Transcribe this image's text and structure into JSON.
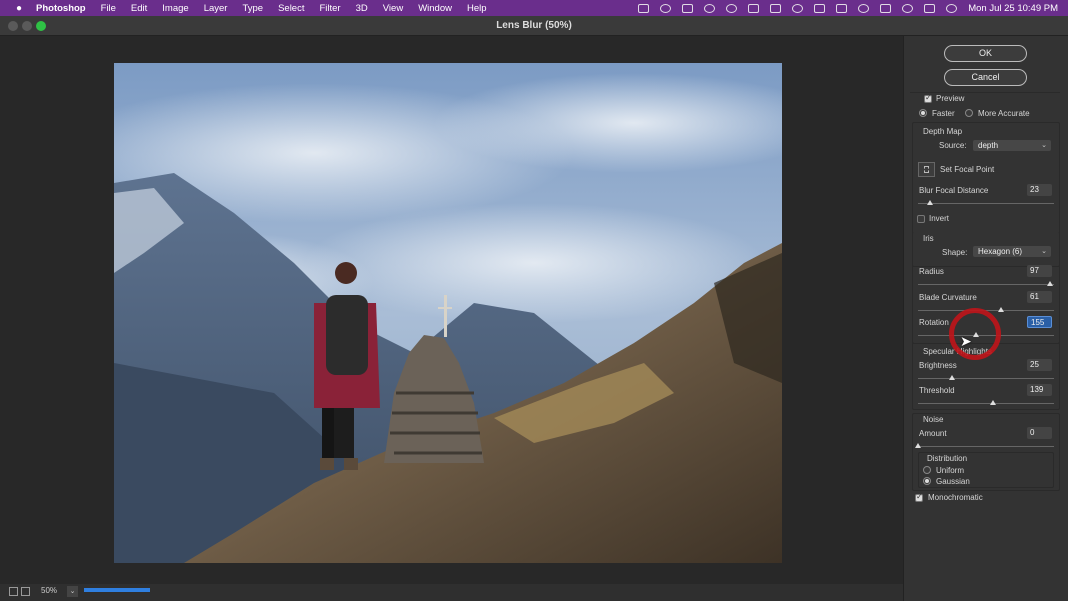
{
  "menubar": {
    "app_name": "Photoshop",
    "items": [
      "File",
      "Edit",
      "Image",
      "Layer",
      "Type",
      "Select",
      "Filter",
      "3D",
      "View",
      "Window",
      "Help"
    ],
    "clock": "Mon Jul 25  10:49 PM"
  },
  "window": {
    "title": "Lens Blur (50%)"
  },
  "status": {
    "zoom": "50%",
    "progress": 0.22
  },
  "dialog": {
    "ok_label": "OK",
    "cancel_label": "Cancel",
    "preview_label": "Preview",
    "preview_checked": true,
    "faster_label": "Faster",
    "more_accurate_label": "More Accurate",
    "quality": "Faster",
    "depth_map": {
      "heading": "Depth Map",
      "source_label": "Source:",
      "source_value": "depth",
      "set_focal_point_label": "Set Focal Point",
      "blur_focal_distance_label": "Blur Focal Distance",
      "blur_focal_distance_value": "23",
      "blur_focal_distance_fraction": 0.09,
      "invert_label": "Invert",
      "invert_checked": false
    },
    "iris": {
      "heading": "Iris",
      "shape_label": "Shape:",
      "shape_value": "Hexagon (6)",
      "radius_label": "Radius",
      "radius_value": "97",
      "radius_fraction": 0.97,
      "blade_curvature_label": "Blade Curvature",
      "blade_curvature_value": "61",
      "blade_curvature_fraction": 0.61,
      "rotation_label": "Rotation",
      "rotation_value": "155",
      "rotation_fraction": 0.43
    },
    "specular": {
      "heading": "Specular Highlights",
      "brightness_label": "Brightness",
      "brightness_value": "25",
      "brightness_fraction": 0.25,
      "threshold_label": "Threshold",
      "threshold_value": "139",
      "threshold_fraction": 0.55
    },
    "noise": {
      "heading": "Noise",
      "amount_label": "Amount",
      "amount_value": "0",
      "amount_fraction": 0.0,
      "distribution_heading": "Distribution",
      "uniform_label": "Uniform",
      "gaussian_label": "Gaussian",
      "distribution": "Gaussian",
      "monochromatic_label": "Monochromatic",
      "monochromatic_checked": true
    }
  },
  "colors": {
    "menubar": "#6a2e8c",
    "panel": "#333333",
    "focus_field": "#2a5fa6",
    "cursor_ring": "#c0141a",
    "progress": "#2f7fe0"
  }
}
